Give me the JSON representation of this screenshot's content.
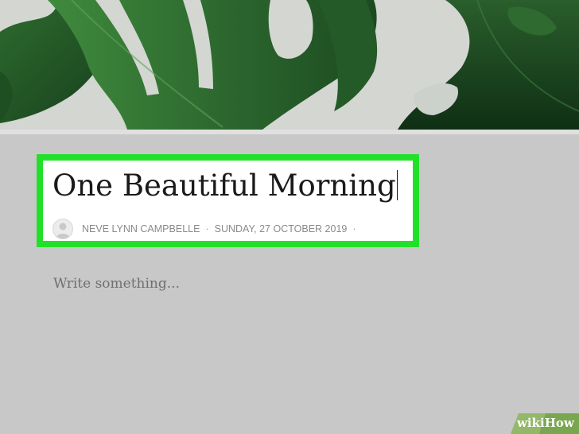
{
  "post": {
    "title": "One Beautiful Morning",
    "author": "NEVE LYNN CAMPBELLE",
    "separator": "·",
    "date": "SUNDAY, 27 OCTOBER 2019",
    "trailing_separator": "·",
    "body_placeholder": "Write something..."
  },
  "watermark": {
    "part1": "wiki",
    "part2": "How"
  },
  "colors": {
    "highlight": "#22e02a",
    "page_background": "#c8c8c8",
    "leaf_dark": "#1f4f25",
    "leaf_light": "#3b7a3a"
  },
  "icons": {
    "avatar": "user-avatar-icon"
  }
}
